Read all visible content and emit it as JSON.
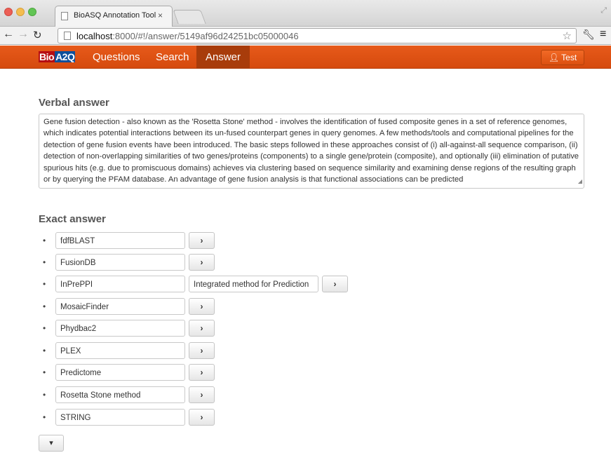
{
  "browser": {
    "tab_title": "BioASQ Annotation Tool",
    "tab_close": "×",
    "url_host": "localhost",
    "url_rest": ":8000/#!/answer/5149af96d24251bc05000046"
  },
  "navbar": {
    "brand_bio": "Bio",
    "brand_aqo": "A2Q",
    "items": [
      "Questions",
      "Search",
      "Answer"
    ],
    "active": "Answer",
    "user_label": "Test"
  },
  "verbal": {
    "title": "Verbal answer",
    "text": "Gene fusion detection - also known as the 'Rosetta Stone' method - involves the identification of fused composite genes in a set of reference genomes, which indicates potential interactions between its un-fused counterpart genes in query genomes. A few methods/tools and computational pipelines for the detection of gene fusion events have been introduced. The basic steps followed in these approaches consist of (i) all-against-all sequence comparison, (ii) detection of non-overlapping similarities of two genes/proteins (components) to a single gene/protein (composite), and optionally (iii) elimination of putative spurious hits (e.g. due to promiscuous domains) achieves via clustering based on sequence similarity and examining dense regions of the resulting graph or by querying the PFAM database. An advantage of gene fusion analysis is that functional associations can be predicted"
  },
  "exact": {
    "title": "Exact answer",
    "bullet": "•",
    "go_icon": "›",
    "items": [
      {
        "value": "fdfBLAST"
      },
      {
        "value": "FusionDB"
      },
      {
        "value": "InPrePPI",
        "extra": "Integrated method for Prediction"
      },
      {
        "value": "MosaicFinder"
      },
      {
        "value": "Phydbac2"
      },
      {
        "value": "PLEX"
      },
      {
        "value": "Predictome"
      },
      {
        "value": "Rosetta Stone method"
      },
      {
        "value": "STRING"
      }
    ],
    "more_icon": "chevron-down-icon"
  }
}
